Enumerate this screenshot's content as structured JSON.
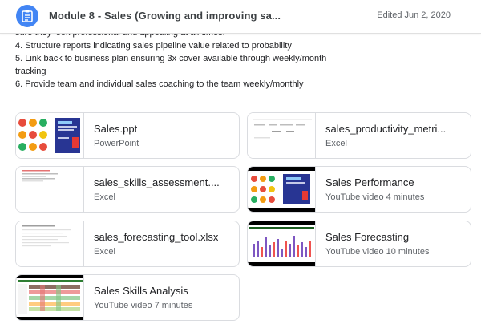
{
  "header": {
    "icon": "assignment-icon",
    "title": "Module 8 - Sales (Growing and improving sa...",
    "edited": "Edited Jun 2, 2020"
  },
  "description": {
    "lines": [
      "sure they look professional and appealing at all times.",
      "4. Structure reports indicating sales pipeline value related to probability",
      "5. Link back to business plan ensuring 3x cover available through weekly/month",
      "tracking",
      "6. Provide team and individual sales coaching to the team weekly/monthly"
    ]
  },
  "attachments": [
    {
      "title": "Sales.ppt",
      "meta": "PowerPoint",
      "thumb": "slides-thumbnail"
    },
    {
      "title": "sales_productivity_metri...",
      "meta": "Excel",
      "thumb": "spreadsheet-thumbnail"
    },
    {
      "title": "sales_skills_assessment....",
      "meta": "Excel",
      "thumb": "spreadsheet-thumbnail"
    },
    {
      "title": "Sales Performance",
      "meta": "YouTube video   4 minutes",
      "thumb": "video-thumbnail"
    },
    {
      "title": "sales_forecasting_tool.xlsx",
      "meta": "Excel",
      "thumb": "spreadsheet-thumbnail"
    },
    {
      "title": "Sales Forecasting",
      "meta": "YouTube video   10 minutes",
      "thumb": "video-thumbnail"
    },
    {
      "title": "Sales Skills Analysis",
      "meta": "YouTube video   7 minutes",
      "thumb": "video-thumbnail"
    }
  ],
  "colors": {
    "accent": "#4285f4",
    "border": "#dadce0",
    "text": "#202124",
    "secondary_text": "#5f6368"
  }
}
